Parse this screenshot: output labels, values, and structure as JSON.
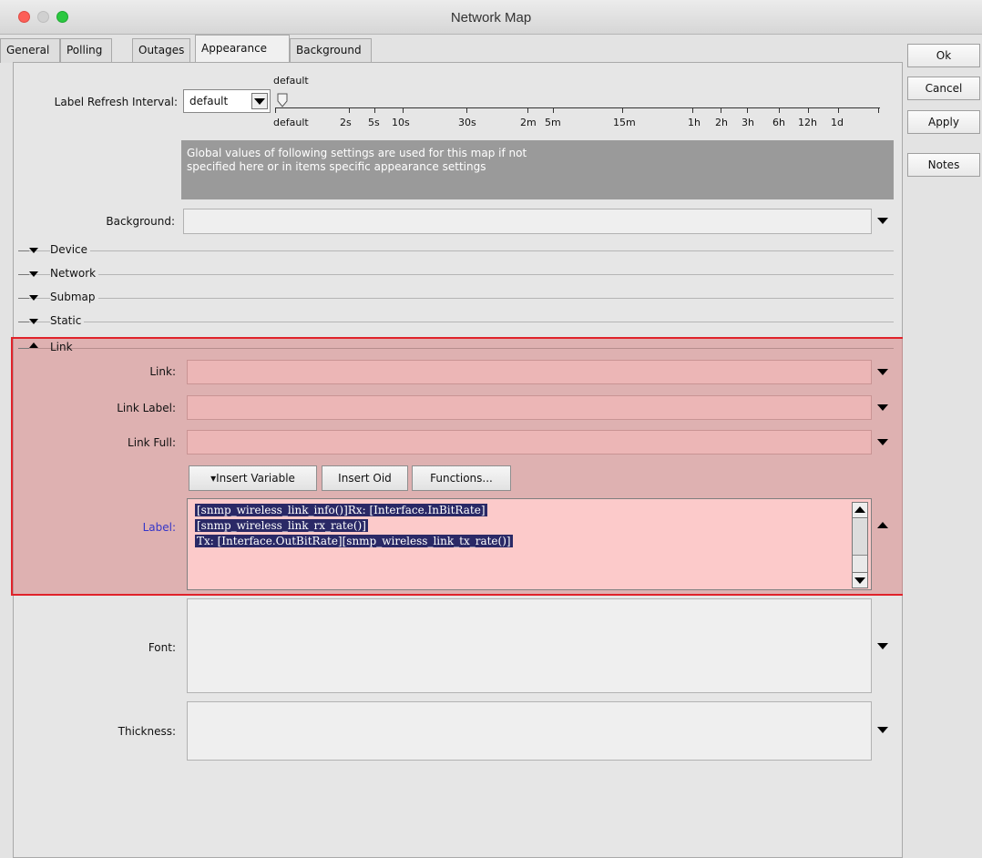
{
  "window": {
    "title": "Network Map"
  },
  "tabs": [
    {
      "label": "General"
    },
    {
      "label": "Polling"
    },
    {
      "label": "Outages"
    },
    {
      "label": "Appearance"
    },
    {
      "label": "Background"
    }
  ],
  "buttons": {
    "ok": "Ok",
    "cancel": "Cancel",
    "apply": "Apply",
    "notes": "Notes"
  },
  "refresh": {
    "label": "Label Refresh Interval:",
    "selected": "default",
    "slider_value": "default",
    "ticks": [
      "default",
      "2s",
      "5s",
      "10s",
      "30s",
      "2m",
      "5m",
      "15m",
      "1h",
      "2h",
      "3h",
      "6h",
      "12h",
      "1d"
    ]
  },
  "info_text": "Global values of following settings are used for this map if not specified here or in items specific appearance settings",
  "background": {
    "label": "Background:",
    "value": ""
  },
  "sections": [
    {
      "name": "Device",
      "state": "collapsed"
    },
    {
      "name": "Network",
      "state": "collapsed"
    },
    {
      "name": "Submap",
      "state": "collapsed"
    },
    {
      "name": "Static",
      "state": "collapsed"
    },
    {
      "name": "Link",
      "state": "expanded"
    }
  ],
  "link": {
    "link_label": "Link:",
    "link_label_label": "Link Label:",
    "link_full_label": "Link Full:",
    "insert_variable": "▾Insert Variable",
    "insert_oid": "Insert Oid",
    "functions": "Functions...",
    "label_label": "Label:",
    "label_lines": [
      "[snmp_wireless_link_info()]Rx: [Interface.InBitRate]",
      "[snmp_wireless_link_rx_rate()]",
      "Tx: [Interface.OutBitRate][snmp_wireless_link_tx_rate()]"
    ]
  },
  "font": {
    "label": "Font:"
  },
  "thickness": {
    "label": "Thickness:"
  },
  "colors": {
    "highlight": "#e0222a",
    "selection": "#2a2966",
    "info_bg": "#9a9a9a"
  }
}
